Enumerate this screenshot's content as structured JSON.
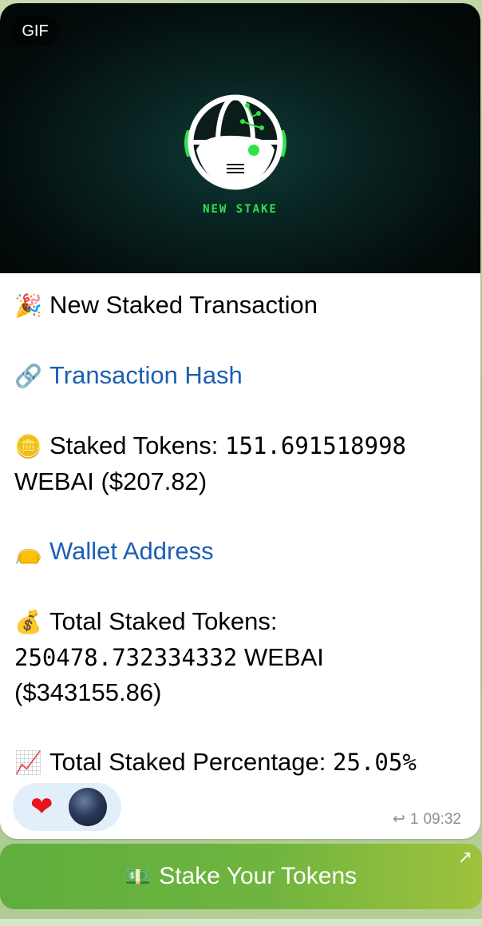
{
  "media": {
    "badge": "GIF",
    "logo_caption": "NEW STAKE"
  },
  "message": {
    "title_emoji": "🎉",
    "title": "New Staked Transaction",
    "hash_emoji": "🔗",
    "hash_link": "Transaction Hash",
    "staked_emoji": "🪙",
    "staked_label": "Staked Tokens: ",
    "staked_amount": "151.691518998",
    "staked_unit_usd": "WEBAI ($207.82)",
    "wallet_emoji": "👝",
    "wallet_link": "Wallet Address",
    "total_emoji": "💰",
    "total_label": "Total Staked Tokens:",
    "total_amount": "250478.732334332",
    "total_unit": " WEBAI",
    "total_usd": "($343155.86)",
    "pct_emoji": "📈",
    "pct_label": "Total Staked Percentage: ",
    "pct_value": "25.05%"
  },
  "reactions": {
    "heart": "❤"
  },
  "meta": {
    "reply_icon": "↩",
    "reply_count": "1",
    "time": "09:32"
  },
  "cta": {
    "emoji": "💵",
    "label": "Stake Your Tokens",
    "arrow": "↗"
  },
  "colors": {
    "link": "#1a5fb4",
    "accent_green": "#2ee24a",
    "cta_green": "#6fb43f"
  }
}
